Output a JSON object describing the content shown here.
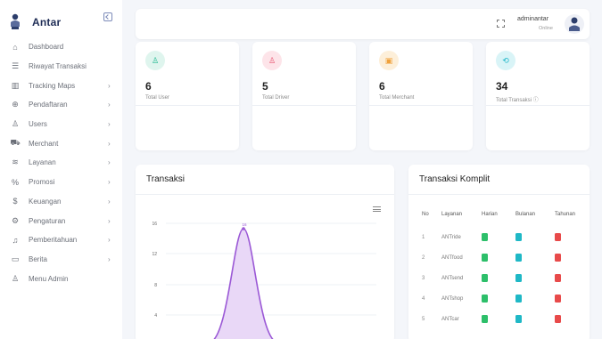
{
  "brand": {
    "name": "Antar"
  },
  "sidebar": {
    "items": [
      {
        "label": "Dashboard",
        "icon": "dashboard-icon",
        "glyph": "⌂",
        "has_children": false
      },
      {
        "label": "Riwayat Transaksi",
        "icon": "list-icon",
        "glyph": "☰",
        "has_children": false
      },
      {
        "label": "Tracking Maps",
        "icon": "map-icon",
        "glyph": "▥",
        "has_children": true
      },
      {
        "label": "Pendaftaran",
        "icon": "plus-circle-icon",
        "glyph": "⊕",
        "has_children": true
      },
      {
        "label": "Users",
        "icon": "user-icon",
        "glyph": "♙",
        "has_children": true
      },
      {
        "label": "Merchant",
        "icon": "cart-icon",
        "glyph": "⛟",
        "has_children": true
      },
      {
        "label": "Layanan",
        "icon": "layers-icon",
        "glyph": "≋",
        "has_children": true
      },
      {
        "label": "Promosi",
        "icon": "percent-icon",
        "glyph": "%",
        "has_children": true
      },
      {
        "label": "Keuangan",
        "icon": "dollar-icon",
        "glyph": "$",
        "has_children": true
      },
      {
        "label": "Pengaturan",
        "icon": "gear-icon",
        "glyph": "⚙",
        "has_children": true
      },
      {
        "label": "Pemberitahuan",
        "icon": "bell-icon",
        "glyph": "♫",
        "has_children": true
      },
      {
        "label": "Berita",
        "icon": "book-icon",
        "glyph": "▭",
        "has_children": true
      },
      {
        "label": "Menu Admin",
        "icon": "user-plus-icon",
        "glyph": "♙",
        "has_children": false
      }
    ],
    "chevron": "›"
  },
  "topbar": {
    "user_name": "adminantar",
    "user_status": "Online"
  },
  "stats": [
    {
      "value": "6",
      "label": "Total User",
      "icon": "user-icon",
      "glyph": "♙",
      "color": "#1fb88f",
      "bg": "#dff5ee"
    },
    {
      "value": "5",
      "label": "Total Driver",
      "icon": "users-icon",
      "glyph": "♙",
      "color": "#e8546f",
      "bg": "#fde4e9"
    },
    {
      "value": "6",
      "label": "Total Merchant",
      "icon": "calendar-icon",
      "glyph": "▣",
      "color": "#f0a13c",
      "bg": "#fdefd9"
    },
    {
      "value": "34",
      "label": "Total Transaksi",
      "icon": "refresh-icon",
      "glyph": "⟲",
      "color": "#20b7c9",
      "bg": "#d9f4f7",
      "info_icon": "ⓘ"
    }
  ],
  "transaksi_chart": {
    "title": "Transaksi",
    "menu_icon": "hamburger-icon"
  },
  "chart_data": {
    "type": "area",
    "title": "Transaksi",
    "y_ticks": [
      "16",
      "12",
      "8",
      "4"
    ],
    "peak_label": "16",
    "peak_value": 16,
    "line_color": "#9b59d6",
    "fill_color": "#e9d8f7"
  },
  "komplit": {
    "title": "Transaksi Komplit",
    "headers": [
      "No",
      "Layanan",
      "Harian",
      "Bulanan",
      "Tahunan"
    ],
    "rows": [
      {
        "no": "1",
        "service": "ANTride",
        "harian": "#2dbf6a",
        "bulanan": "#1fb8c6",
        "tahunan": "#e84a4a"
      },
      {
        "no": "2",
        "service": "ANTfood",
        "harian": "#2dbf6a",
        "bulanan": "#1fb8c6",
        "tahunan": "#e84a4a"
      },
      {
        "no": "3",
        "service": "ANTsend",
        "harian": "#2dbf6a",
        "bulanan": "#1fb8c6",
        "tahunan": "#e84a4a"
      },
      {
        "no": "4",
        "service": "ANTshop",
        "harian": "#2dbf6a",
        "bulanan": "#1fb8c6",
        "tahunan": "#e84a4a"
      },
      {
        "no": "5",
        "service": "ANTcar",
        "harian": "#2dbf6a",
        "bulanan": "#1fb8c6",
        "tahunan": "#e84a4a"
      }
    ]
  }
}
